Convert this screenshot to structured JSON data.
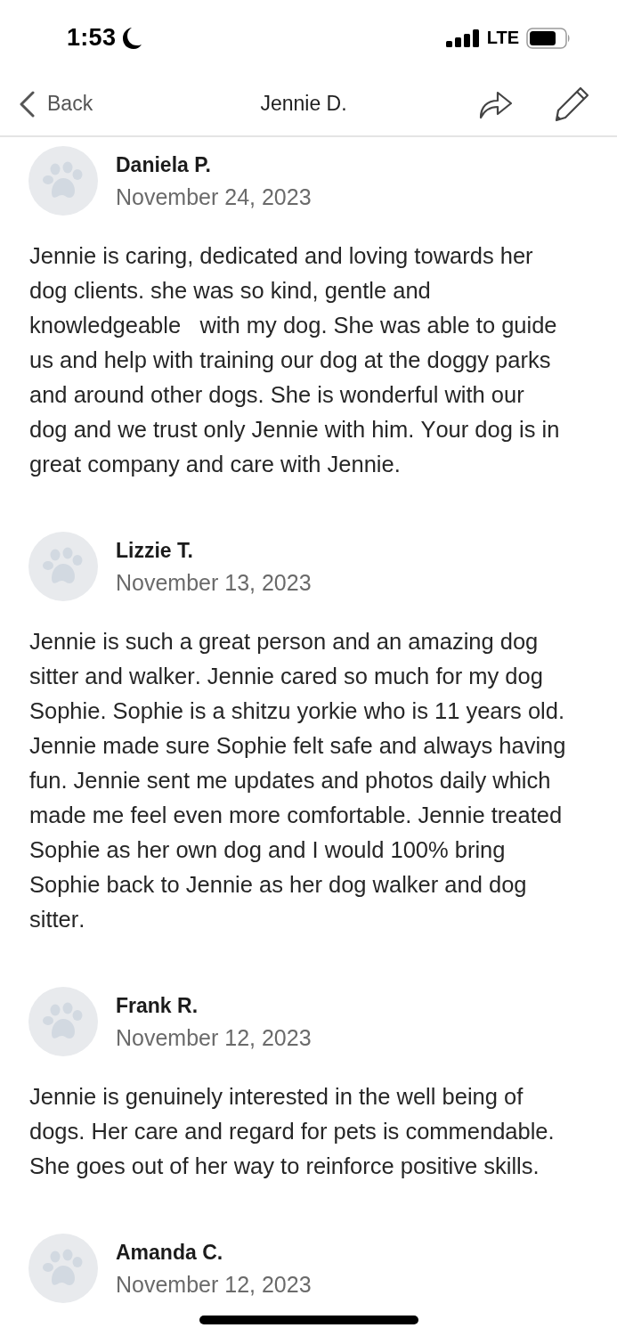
{
  "status_bar": {
    "time": "1:53",
    "network": "LTE"
  },
  "nav": {
    "back": "Back",
    "title": "Jennie D."
  },
  "reviews": [
    {
      "name": "Daniela P.",
      "date": "November 24, 2023",
      "text": "Jennie is caring, dedicated and loving towards her dog clients. she was so kind, gentle and knowledgeable   with my dog. She was able to guide us and help with training our dog at the doggy parks and around other dogs. She is wonderful with our dog and we trust only Jennie with him. Your dog is in great company and care with Jennie."
    },
    {
      "name": "Lizzie T.",
      "date": "November 13, 2023",
      "text": "Jennie is such a great person and an amazing dog sitter and walker. Jennie cared so much for my dog Sophie. Sophie is a shitzu yorkie who is 11 years old. Jennie made sure Sophie felt safe and always having fun. Jennie sent me updates and photos daily which made me feel even more comfortable. Jennie treated Sophie as her own dog and I would 100% bring Sophie back to Jennie as her dog walker and dog sitter."
    },
    {
      "name": "Frank R.",
      "date": "November 12, 2023",
      "text": "Jennie is genuinely interested in the well being of dogs. Her care and regard for pets is commendable. She goes out of her way to reinforce positive skills."
    },
    {
      "name": "Amanda C.",
      "date": "November 12, 2023"
    }
  ]
}
